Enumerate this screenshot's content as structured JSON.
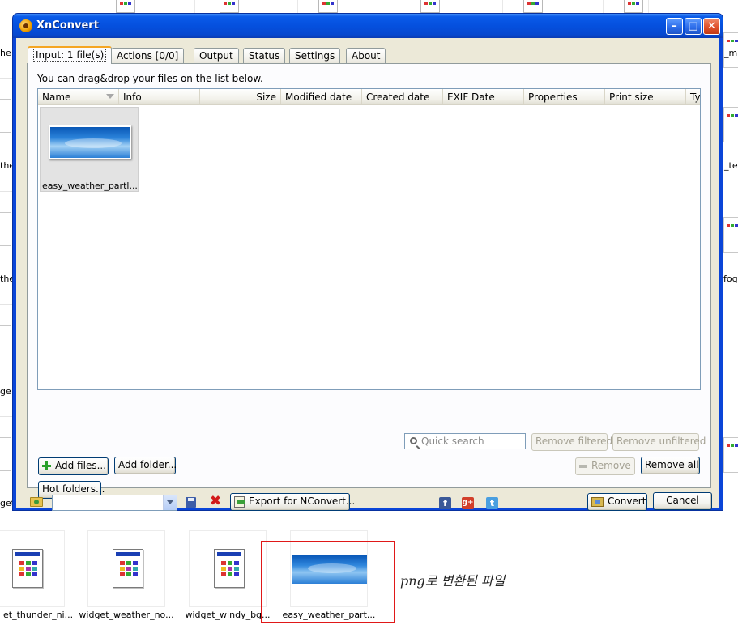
{
  "window": {
    "title": "XnConvert"
  },
  "tabs": [
    {
      "label": "Input: 1 file(s)",
      "active": true
    },
    {
      "label": "Actions [0/0]",
      "active": false
    },
    {
      "label": "Output",
      "active": false
    },
    {
      "label": "Status",
      "active": false
    },
    {
      "label": "Settings",
      "active": false
    },
    {
      "label": "About",
      "active": false
    }
  ],
  "input": {
    "hint": "You can drag&drop your files on the list below.",
    "columns": [
      "Name",
      "Info",
      "Size",
      "Modified date",
      "Created date",
      "EXIF Date",
      "Properties",
      "Print size",
      "Ty"
    ],
    "files": [
      {
        "name": "easy_weather_partl..."
      }
    ],
    "search_placeholder": "Quick search",
    "buttons": {
      "remove_filtered": "Remove filtered",
      "remove_unfiltered": "Remove unfiltered",
      "add_files": "Add files...",
      "add_folder": "Add folder...",
      "remove": "Remove",
      "remove_all": "Remove all",
      "hot_folders": "Hot folders..."
    }
  },
  "bottom_bar": {
    "preset_value": "",
    "export": "Export for NConvert...",
    "convert": "Convert",
    "cancel": "Cancel",
    "social": [
      "f",
      "g+",
      "t"
    ]
  },
  "background": {
    "left_edge_labels": [
      "he",
      "the",
      "the",
      "ge",
      "get_"
    ],
    "right_edge_labels": [
      "_m",
      "_te",
      "fog"
    ],
    "files": [
      {
        "label": "et_thunder_ni..."
      },
      {
        "label": "widget_weather_no..."
      },
      {
        "label": "widget_windy_bg..."
      },
      {
        "label": "easy_weather_part..."
      }
    ],
    "annotation": "png로 변환된 파일"
  },
  "colors": {
    "titlebar": "#0550de",
    "dialog_bg": "#ece9d8",
    "highlight": "#e01818",
    "facebook": "#3b5998",
    "googleplus": "#d23f2a",
    "twitter": "#4a9fe0"
  }
}
